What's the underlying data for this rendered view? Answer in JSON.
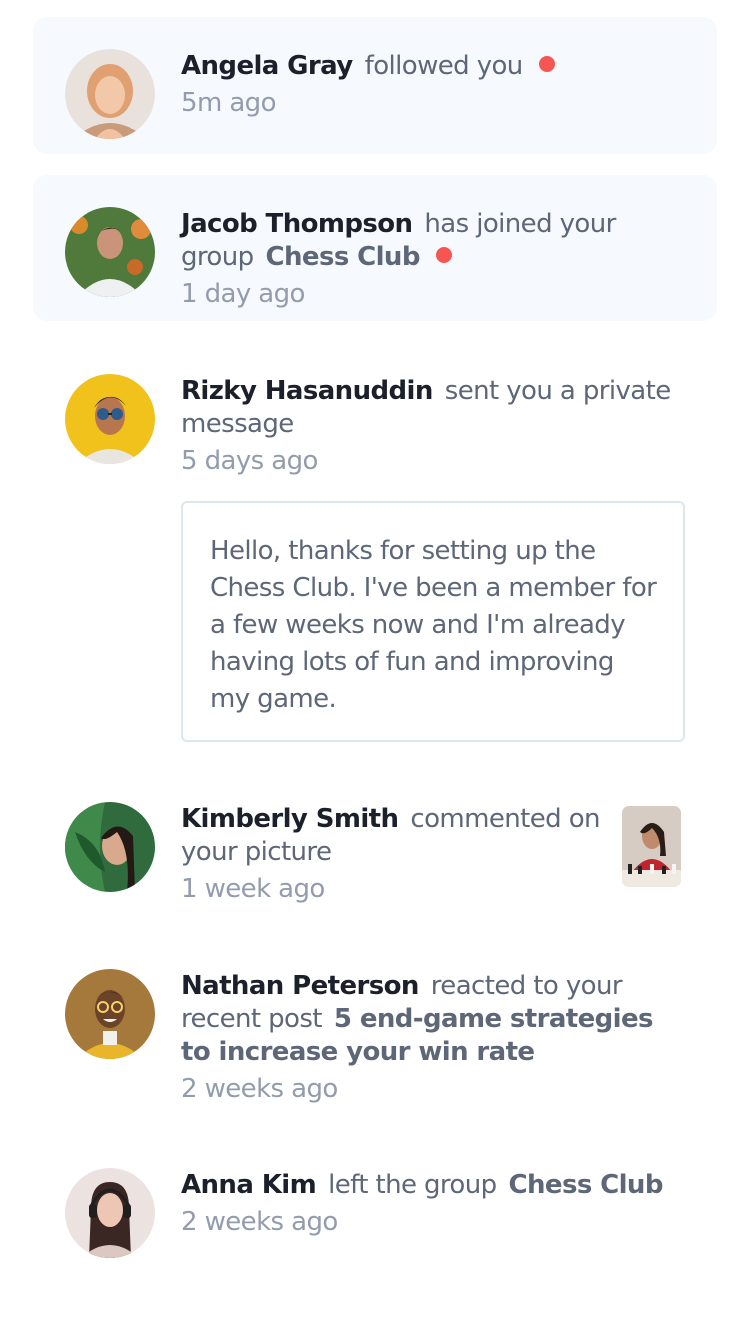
{
  "notifications": [
    {
      "name": "Angela Gray",
      "action": "followed you",
      "time": "5m ago",
      "unread": true,
      "avatar_icon": "avatar-angela-gray"
    },
    {
      "name": "Jacob Thompson",
      "action": "has joined your",
      "action_cont": "group",
      "target": "Chess Club",
      "time": "1 day ago",
      "unread": true,
      "avatar_icon": "avatar-jacob-thompson"
    },
    {
      "name": "Rizky Hasanuddin",
      "action": "sent you a private",
      "action_cont": "message",
      "time": "5 days ago",
      "unread": false,
      "message": "Hello, thanks for setting up the Chess Club. I've been a member for a few weeks now and I'm already having lots of fun and improving my game.",
      "avatar_icon": "avatar-rizky-hasanuddin"
    },
    {
      "name": "Kimberly Smith",
      "action": "commented on",
      "action_cont": "your picture",
      "time": "1 week ago",
      "unread": false,
      "avatar_icon": "avatar-kimberly-smith",
      "picture_icon": "chess-picture-thumbnail"
    },
    {
      "name": "Nathan Peterson",
      "action": "reacted to your",
      "action_cont": "recent post",
      "target": "5 end-game strategies",
      "target_cont": "to increase your win rate",
      "time": "2 weeks ago",
      "unread": false,
      "avatar_icon": "avatar-nathan-peterson"
    },
    {
      "name": "Anna Kim",
      "action": "left the group",
      "target": "Chess Club",
      "time": "2 weeks ago",
      "unread": false,
      "avatar_icon": "avatar-anna-kim"
    }
  ],
  "colors": {
    "unread_background": "#f6f9fd",
    "unread_dot": "#f65552",
    "name_text": "#1c202b",
    "body_text": "#5e6778",
    "time_text": "#939cad",
    "message_border": "#dde7ee"
  }
}
